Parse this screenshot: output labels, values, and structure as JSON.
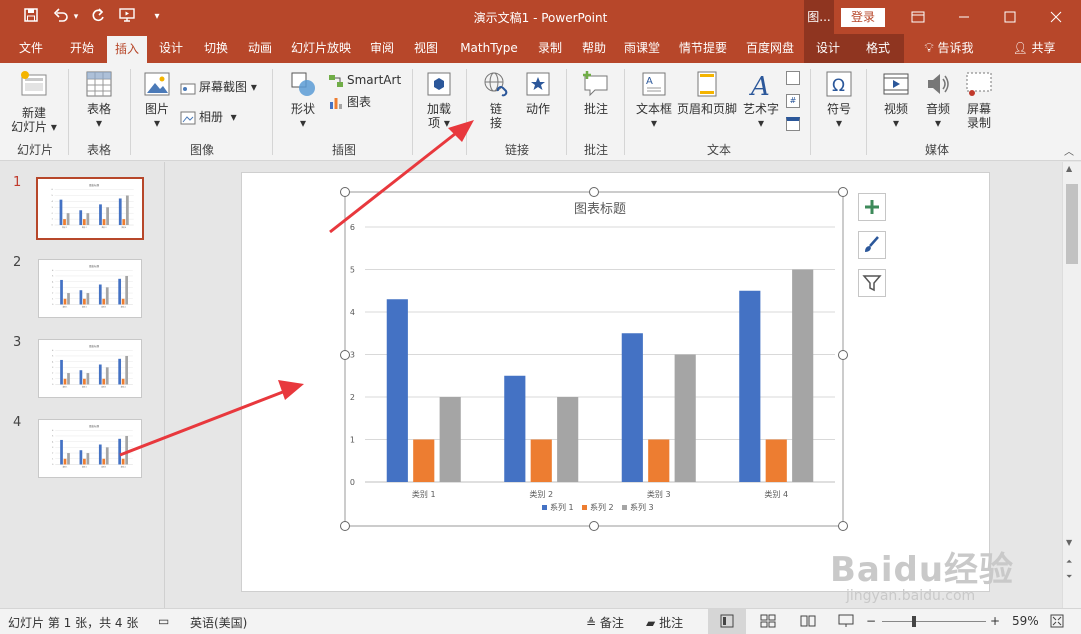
{
  "titlebar": {
    "title": "演示文稿1  -  PowerPoint",
    "context_group": "图...",
    "login": "登录",
    "qa_icons": [
      "save-icon",
      "undo-icon",
      "redo-icon",
      "present-icon",
      "customize-icon"
    ],
    "window_icons": [
      "ribbon-display-icon",
      "minimize-icon",
      "maximize-icon",
      "close-icon"
    ]
  },
  "tabs": [
    "文件",
    "开始",
    "插入",
    "设计",
    "切换",
    "动画",
    "幻灯片放映",
    "审阅",
    "视图",
    "MathType",
    "录制",
    "帮助",
    "雨课堂",
    "情节提要",
    "百度网盘",
    "设计",
    "格式"
  ],
  "active_tab": "插入",
  "tellme": "告诉我",
  "share": "共享",
  "ribbon": {
    "new_slide": [
      "新建",
      "幻灯片"
    ],
    "table": "表格",
    "picture": "图片",
    "screenshot": "屏幕截图",
    "album": "相册",
    "shapes": "形状",
    "smartart": "SmartArt",
    "chart": "图表",
    "addins": [
      "加载",
      "项"
    ],
    "link": [
      "链",
      "接"
    ],
    "action": "动作",
    "comment": "批注",
    "textbox": "文本框",
    "header_footer": "页眉和页脚",
    "wordart": "艺术字",
    "symbol": "符号",
    "video": "视频",
    "audio": "音频",
    "screen_record": [
      "屏幕",
      "录制"
    ],
    "groups": [
      "幻灯片",
      "表格",
      "图像",
      "插图",
      "链接",
      "批注",
      "文本",
      "媒体"
    ]
  },
  "thumbnails": [
    "1",
    "2",
    "3",
    "4"
  ],
  "chart_data": {
    "type": "bar",
    "title": "图表标题",
    "categories": [
      "类别 1",
      "类别 2",
      "类别 3",
      "类别 4"
    ],
    "series": [
      {
        "name": "系列 1",
        "values": [
          4.3,
          2.5,
          3.5,
          4.5
        ],
        "color": "#4472c4"
      },
      {
        "name": "系列 2",
        "values": [
          1,
          1,
          1,
          1
        ],
        "color": "#ed7d31"
      },
      {
        "name": "系列 3",
        "values": [
          2,
          2,
          3,
          5
        ],
        "color": "#a5a5a5"
      }
    ],
    "ylim": [
      0,
      6
    ],
    "yticks": [
      "0",
      "1",
      "2",
      "3",
      "4",
      "5",
      "6"
    ],
    "grid": true,
    "legend": "bottom"
  },
  "chart_side_buttons": [
    "chart-elements-icon",
    "chart-styles-icon",
    "chart-filter-icon"
  ],
  "status": {
    "slide_info": "幻灯片 第 1 张，共 4 张",
    "language": "英语(美国)",
    "notes": "备注",
    "comments": "批注",
    "zoom": "59%"
  },
  "watermark": {
    "logo": "Baidu经验",
    "url": "jingyan.baidu.com"
  },
  "colors": {
    "brand": "#b7472a",
    "arrow": "#e8383d"
  }
}
